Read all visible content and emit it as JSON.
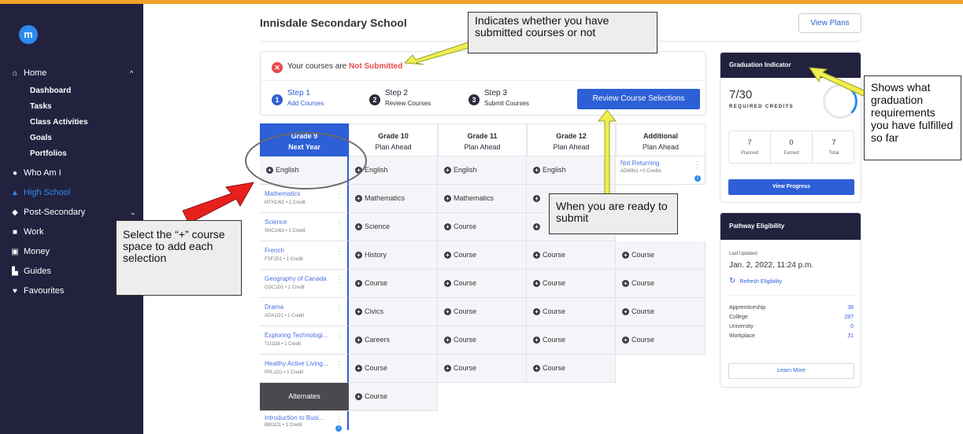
{
  "brand": {
    "logo_letter": "m"
  },
  "sidebar": {
    "home": {
      "icon": "home-icon",
      "label": "Home",
      "chevron": "^"
    },
    "home_sub": [
      "Dashboard",
      "Tasks",
      "Class Activities",
      "Goals",
      "Portfolios"
    ],
    "items": [
      {
        "icon": "info-icon",
        "label": "Who Am I",
        "glyph": "●"
      },
      {
        "icon": "graduation-cap-icon",
        "label": "High School",
        "glyph": "▲",
        "active": true
      },
      {
        "icon": "mortarboard-icon",
        "label": "Post-Secondary",
        "glyph": "◆",
        "chevron": "⌄"
      },
      {
        "icon": "briefcase-icon",
        "label": "Work",
        "glyph": "■"
      },
      {
        "icon": "money-icon",
        "label": "Money",
        "glyph": "▣"
      },
      {
        "icon": "book-icon",
        "label": "Guides",
        "glyph": "▙"
      },
      {
        "icon": "heart-icon",
        "label": "Favourites",
        "glyph": "♥"
      }
    ]
  },
  "header": {
    "school_name": "Innisdale Secondary School",
    "view_plans": "View Plans"
  },
  "status": {
    "prefix": "Your courses are",
    "state": "Not Submitted",
    "steps": [
      {
        "num": "1",
        "title": "Step 1",
        "subtitle": "Add Courses"
      },
      {
        "num": "2",
        "title": "Step 2",
        "subtitle": "Review Courses"
      },
      {
        "num": "3",
        "title": "Step 3",
        "subtitle": "Submit Courses"
      }
    ],
    "review_button": "Review Course Selections"
  },
  "grades": {
    "headers": [
      {
        "title": "Grade 9",
        "subtitle": "Next Year"
      },
      {
        "title": "Grade 10",
        "subtitle": "Plan Ahead"
      },
      {
        "title": "Grade 11",
        "subtitle": "Plan Ahead"
      },
      {
        "title": "Grade 12",
        "subtitle": "Plan Ahead"
      },
      {
        "title": "Additional",
        "subtitle": "Plan Ahead"
      }
    ],
    "grade9": {
      "first_add": "English",
      "courses": [
        {
          "name": "Mathematics",
          "code": "MTH1W1 • 1 Credit"
        },
        {
          "name": "Science",
          "code": "SNC1W1 • 1 Credit"
        },
        {
          "name": "French",
          "code": "FSF1D1 • 1 Credit"
        },
        {
          "name": "Geography of Canada",
          "code": "CGC1D1 • 1 Credit"
        },
        {
          "name": "Drama",
          "code": "ADA1O1 • 1 Credit"
        },
        {
          "name": "Exploring Technologi...",
          "code": "TIJ1O8 • 1 Credit"
        },
        {
          "name": "Healthy Active Living...",
          "code": "PPL1O1 • 1 Credit"
        }
      ],
      "alternates_label": "Alternates",
      "alternate": {
        "name": "Introduction to Busi...",
        "code": "BBI1O1 • 1 Credit"
      }
    },
    "grade10": [
      "English",
      "Mathematics",
      "Science",
      "History",
      "Course",
      "Civics",
      "Careers",
      "Course",
      "Course"
    ],
    "grade11": [
      "English",
      "Mathematics",
      "Course",
      "Course",
      "Course",
      "Course",
      "Course",
      "Course"
    ],
    "grade12": [
      "English",
      "",
      "",
      "Course",
      "Course",
      "Course",
      "Course",
      "Course"
    ],
    "additional": {
      "not_returning": {
        "name": "Not Returning",
        "code": "ADMIN1 • 0 Credits"
      },
      "courses": [
        "Course",
        "Course",
        "Course",
        "Course"
      ]
    }
  },
  "graduation": {
    "title": "Graduation Indicator",
    "credits": "7/30",
    "credits_label": "REQUIRED CREDITS",
    "progress_fraction": 0.233,
    "stats": [
      {
        "value": "7",
        "label": "Planned"
      },
      {
        "value": "0",
        "label": "Earned"
      },
      {
        "value": "7",
        "label": "Total"
      }
    ],
    "button": "View Progress"
  },
  "pathway": {
    "title": "Pathway Eligibility",
    "last_updated_label": "Last Updated",
    "last_updated": "Jan. 2, 2022, 11:24 p.m.",
    "refresh": "Refresh Eligibility",
    "rows": [
      {
        "label": "Apprenticeship",
        "value": "38"
      },
      {
        "label": "College",
        "value": "287"
      },
      {
        "label": "University",
        "value": "0"
      },
      {
        "label": "Workplace",
        "value": "31"
      }
    ],
    "button": "Learn More"
  },
  "annotations": {
    "submitted": "Indicates whether you have submitted courses or not",
    "graduation": "Shows what graduation requirements you have fulfilled so far",
    "submit": "When you are ready to submit",
    "plus": "Select the “+” course space to add each selection"
  },
  "colors": {
    "accent": "#2d5fd6",
    "sidebar": "#22223f",
    "alert": "#e84c4c",
    "arrow_yellow": "#eeef4e",
    "arrow_red": "#e8201c"
  }
}
